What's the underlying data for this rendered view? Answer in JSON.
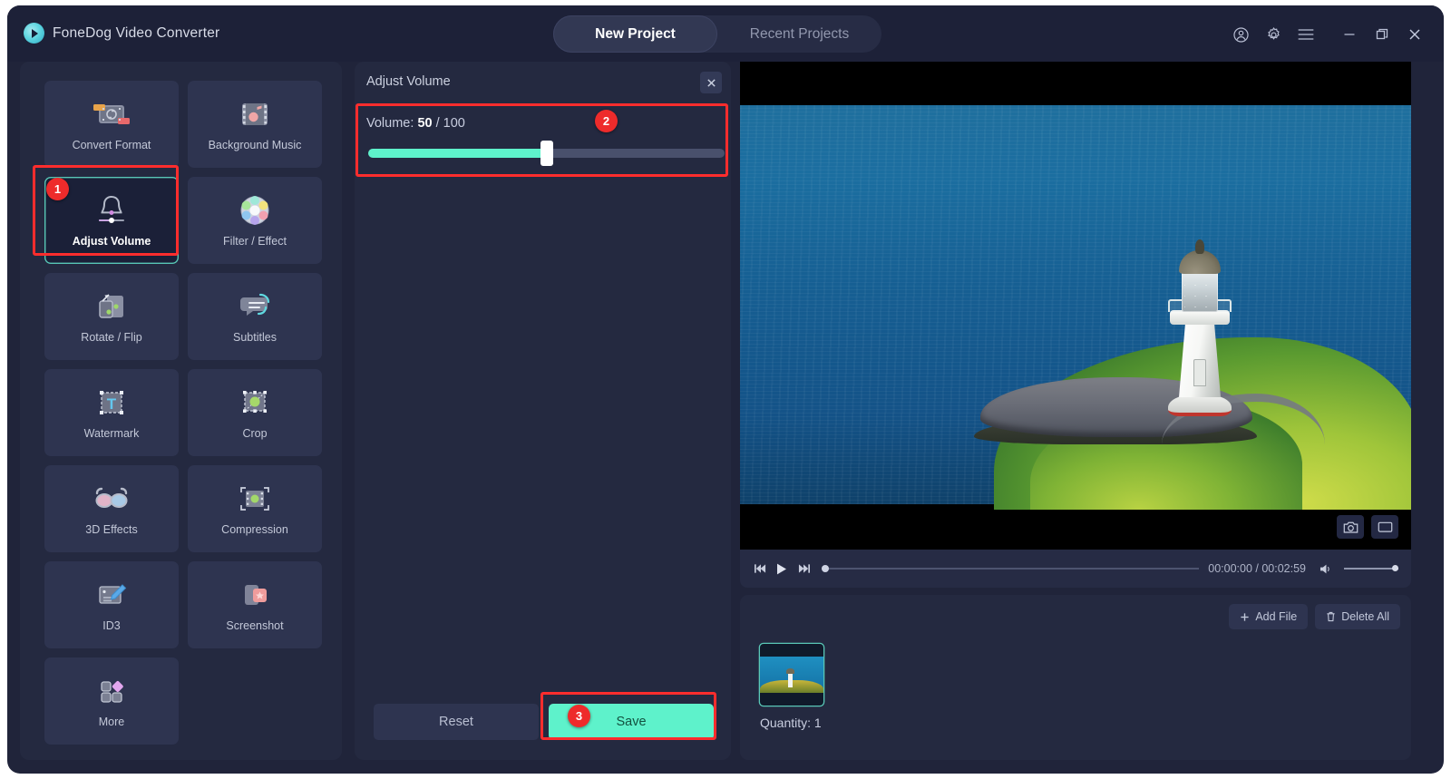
{
  "window": {
    "brand": "FoneDog Video Converter",
    "logo_icon": "play-circle-icon",
    "tabs": [
      {
        "label": "New Project",
        "active": true
      },
      {
        "label": "Recent Projects",
        "active": false
      }
    ],
    "titlebar_icons": [
      {
        "name": "account-icon"
      },
      {
        "name": "settings-gear-icon"
      },
      {
        "name": "menu-hamburger-icon"
      },
      {
        "name": "minimize-icon"
      },
      {
        "name": "maximize-icon"
      },
      {
        "name": "close-icon"
      }
    ]
  },
  "tools": [
    {
      "label": "Convert Format",
      "icon": "convert-format-icon",
      "selected": false
    },
    {
      "label": "Background Music",
      "icon": "background-music-icon",
      "selected": false
    },
    {
      "label": "Adjust Volume",
      "icon": "adjust-volume-bell-icon",
      "selected": true
    },
    {
      "label": "Filter / Effect",
      "icon": "filter-effect-icon",
      "selected": false
    },
    {
      "label": "Rotate / Flip",
      "icon": "rotate-flip-icon",
      "selected": false
    },
    {
      "label": "Subtitles",
      "icon": "subtitles-icon",
      "selected": false
    },
    {
      "label": "Watermark",
      "icon": "watermark-text-icon",
      "selected": false
    },
    {
      "label": "Crop",
      "icon": "crop-icon",
      "selected": false
    },
    {
      "label": "3D Effects",
      "icon": "3d-glasses-icon",
      "selected": false
    },
    {
      "label": "Compression",
      "icon": "compression-icon",
      "selected": false
    },
    {
      "label": "ID3",
      "icon": "id3-tag-edit-icon",
      "selected": false
    },
    {
      "label": "Screenshot",
      "icon": "screenshot-icon",
      "selected": false
    },
    {
      "label": "More",
      "icon": "more-grid-icon",
      "selected": false
    }
  ],
  "edit_panel": {
    "title": "Adjust Volume",
    "close_icon": "close-icon",
    "volume_prefix": "Volume:",
    "volume_value": "50",
    "volume_suffix": "/ 100",
    "volume_percent": 50,
    "reset_label": "Reset",
    "save_label": "Save"
  },
  "annotations": {
    "step1": "1",
    "step2": "2",
    "step3": "3",
    "highlight_color": "#ff2d2d"
  },
  "player": {
    "prev_icon": "skip-previous-icon",
    "play_icon": "play-icon",
    "next_icon": "skip-next-icon",
    "time": "00:00:00 / 00:02:59",
    "speaker_icon": "speaker-icon",
    "progress_percent": 0,
    "volume_percent": 100,
    "snapshot_icon": "camera-icon",
    "fullscreen_icon": "fullscreen-icon"
  },
  "file_list": {
    "add_file_label": "Add File",
    "add_file_icon": "plus-icon",
    "delete_all_label": "Delete All",
    "delete_all_icon": "trash-icon",
    "quantity_label": "Quantity: 1",
    "thumbnail_name": "lighthouse-video-thumbnail"
  },
  "colors": {
    "accent": "#5ef2cb",
    "panel": "#242940",
    "tile": "#2e3450",
    "window_bg": "#20243a",
    "annotation_red": "#ff2d2d"
  }
}
